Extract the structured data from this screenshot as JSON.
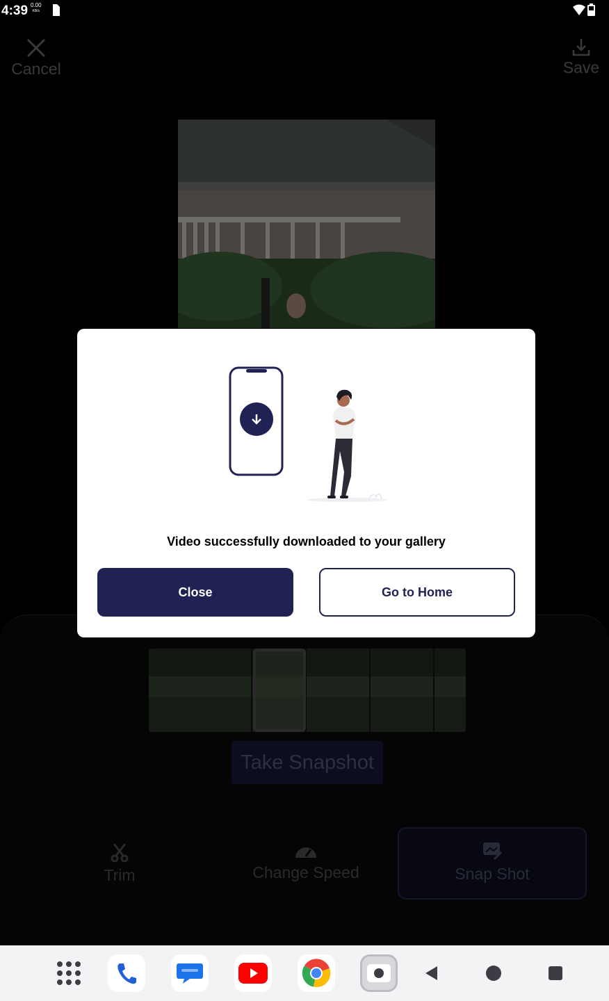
{
  "status_bar": {
    "time": "4:39",
    "data_rate": "0.00",
    "data_unit": "KB/s"
  },
  "editor": {
    "cancel_label": "Cancel",
    "save_label": "Save",
    "take_snapshot_label": "Take Snapshot",
    "tools": {
      "trim_label": "Trim",
      "change_speed_label": "Change Speed",
      "snap_shot_label": "Snap Shot"
    }
  },
  "dialog": {
    "message": "Video successfully downloaded to your gallery",
    "close_label": "Close",
    "go_home_label": "Go to Home",
    "icon": "download-arrow-icon"
  },
  "dock": {
    "apps": [
      "app-drawer-icon",
      "phone-icon",
      "messages-icon",
      "youtube-icon",
      "chrome-icon",
      "screen-recorder-icon"
    ],
    "nav": [
      "back-icon",
      "home-icon",
      "recents-icon"
    ]
  },
  "colors": {
    "primary": "#202254",
    "dialog_bg": "#ffffff",
    "nav_bar_bg": "#f3f3f6"
  }
}
